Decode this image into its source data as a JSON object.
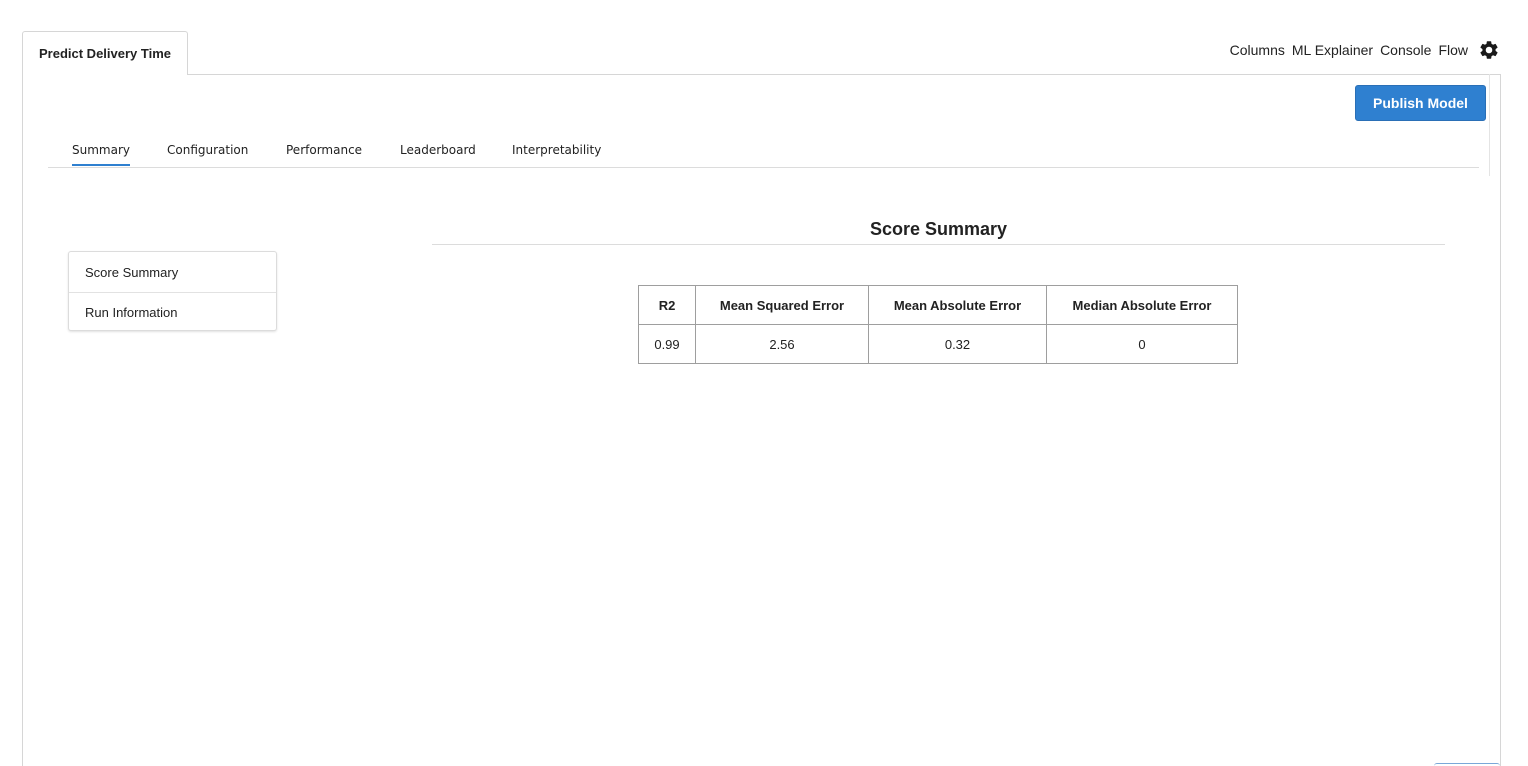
{
  "doc_tab": {
    "label": "Predict Delivery Time"
  },
  "top_nav": {
    "items": [
      "Columns",
      "ML Explainer",
      "Console",
      "Flow"
    ],
    "settings_icon": "gear-icon"
  },
  "toolbar": {
    "publish_label": "Publish Model",
    "publish_color": "#2f80d0"
  },
  "subtabs": {
    "items": [
      "Summary",
      "Configuration",
      "Performance",
      "Leaderboard",
      "Interpretability"
    ],
    "active": "Summary"
  },
  "side_list": {
    "items": [
      "Score Summary",
      "Run Information"
    ]
  },
  "score_summary": {
    "title": "Score Summary",
    "columns": [
      "R2",
      "Mean Squared Error",
      "Mean Absolute Error",
      "Median Absolute Error"
    ],
    "rows": [
      [
        "0.99",
        "2.56",
        "0.32",
        "0"
      ]
    ]
  }
}
